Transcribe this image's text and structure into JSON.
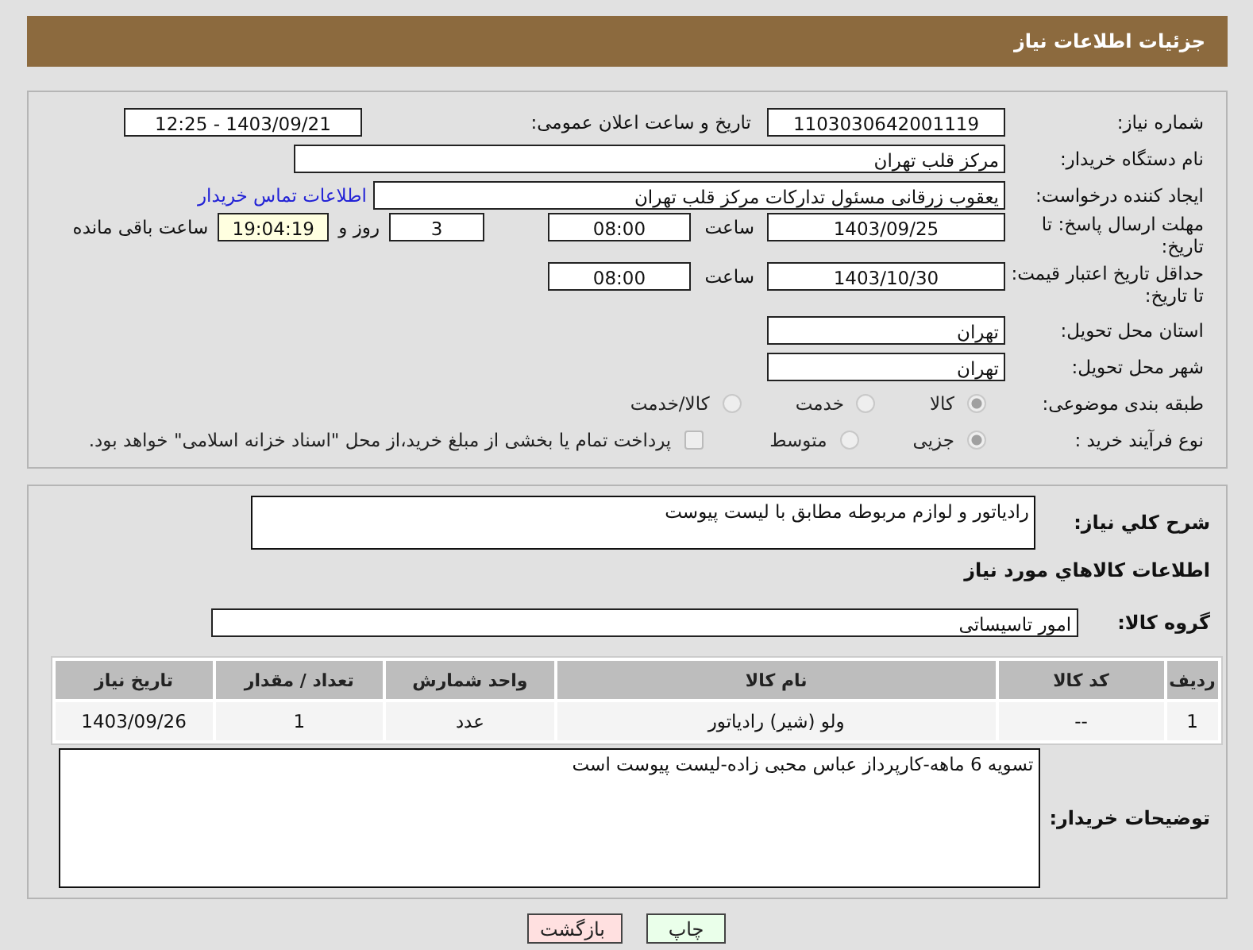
{
  "header": {
    "title": "جزئیات اطلاعات نیاز"
  },
  "details": {
    "need_number": {
      "label": "شماره نیاز:",
      "value": "1103030642001119"
    },
    "announce": {
      "label": "تاریخ و ساعت اعلان عمومی:",
      "value": "1403/09/21 - 12:25"
    },
    "buyer_org": {
      "label": "نام دستگاه خریدار:",
      "value": "مرکز قلب تهران"
    },
    "requester": {
      "label": "ایجاد کننده درخواست:",
      "value": "یعقوب زرقانی مسئول تدارکات مرکز قلب تهران",
      "link": "اطلاعات تماس خریدار"
    },
    "reply_deadline": {
      "label": "مهلت ارسال پاسخ: تا تاریخ:",
      "date": "1403/09/25",
      "time_label": "ساعت",
      "time": "08:00",
      "days": "3",
      "days_label": "روز و",
      "remaining": "19:04:19",
      "remaining_label": "ساعت باقی مانده"
    },
    "price_validity": {
      "label": "حداقل تاریخ اعتبار قیمت: تا تاریخ:",
      "date": "1403/10/30",
      "time_label": "ساعت",
      "time": "08:00"
    },
    "province": {
      "label": "استان محل تحویل:",
      "value": "تهران"
    },
    "city": {
      "label": "شهر محل تحویل:",
      "value": "تهران"
    },
    "category": {
      "label": "طبقه بندی موضوعی:",
      "options": [
        {
          "label": "کالا",
          "selected": true
        },
        {
          "label": "خدمت",
          "selected": false
        },
        {
          "label": "کالا/خدمت",
          "selected": false
        }
      ]
    },
    "process": {
      "label": "نوع فرآیند خرید :",
      "options": [
        {
          "label": "جزیی",
          "selected": true
        },
        {
          "label": "متوسط",
          "selected": false
        }
      ],
      "payment": {
        "label": "پرداخت تمام یا بخشی از مبلغ خرید،از محل \"اسناد خزانه اسلامی\" خواهد بود.",
        "checked": false
      }
    }
  },
  "goods": {
    "summary": {
      "label": "شرح کلي نياز:",
      "value": "رادیاتور و لوازم مربوطه مطابق با لیست پیوست"
    },
    "section_title": "اطلاعات کالاهاي مورد نياز",
    "group": {
      "label": "گروه کالا:",
      "value": "امور تاسیساتی"
    },
    "table": {
      "columns": [
        "رديف",
        "کد کالا",
        "نام کالا",
        "واحد شمارش",
        "تعداد / مقدار",
        "تاریخ نیاز"
      ],
      "rows": [
        [
          "1",
          "--",
          "ولو (شیر) رادیاتور",
          "عدد",
          "1",
          "1403/09/26"
        ]
      ]
    },
    "notes": {
      "label": "توضیحات خریدار:",
      "value": "تسویه 6 ماهه-کارپرداز عباس محبی زاده-لیست پیوست است"
    }
  },
  "buttons": [
    {
      "label": "چاپ",
      "kind": "print"
    },
    {
      "label": "بازگشت",
      "kind": "back"
    }
  ]
}
